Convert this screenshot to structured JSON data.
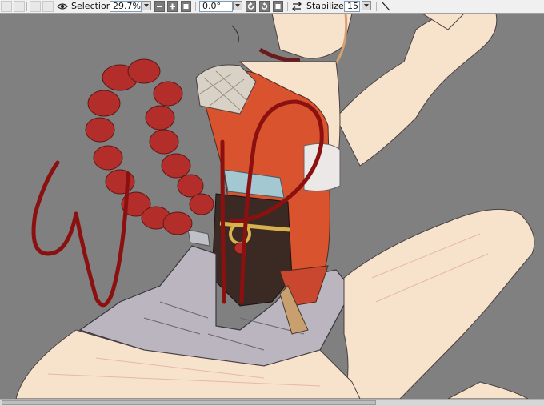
{
  "toolbar": {
    "selection_label": "Selection",
    "zoom_value": "29.7%",
    "rotation_value": "0.0°",
    "stabilizer_label": "Stabilizer",
    "stabilizer_value": "15"
  },
  "canvas": {
    "overlay_text": "WIP",
    "colors": {
      "background": "#808080",
      "wip_stroke": "#8b1010",
      "skin": "#f7e2cc",
      "top": "#d9542e",
      "braid": "#b32e2a",
      "shorts": "#bbb5c0",
      "belt": "#3b2a24",
      "sash": "#a4c8d2",
      "gold": "#d8b24c"
    }
  },
  "icons": [
    "eye-icon",
    "minus-icon",
    "plus-icon",
    "reset-icon",
    "rotate-ccw-icon",
    "rotate-cw-icon",
    "flip-icon",
    "pen-icon"
  ]
}
